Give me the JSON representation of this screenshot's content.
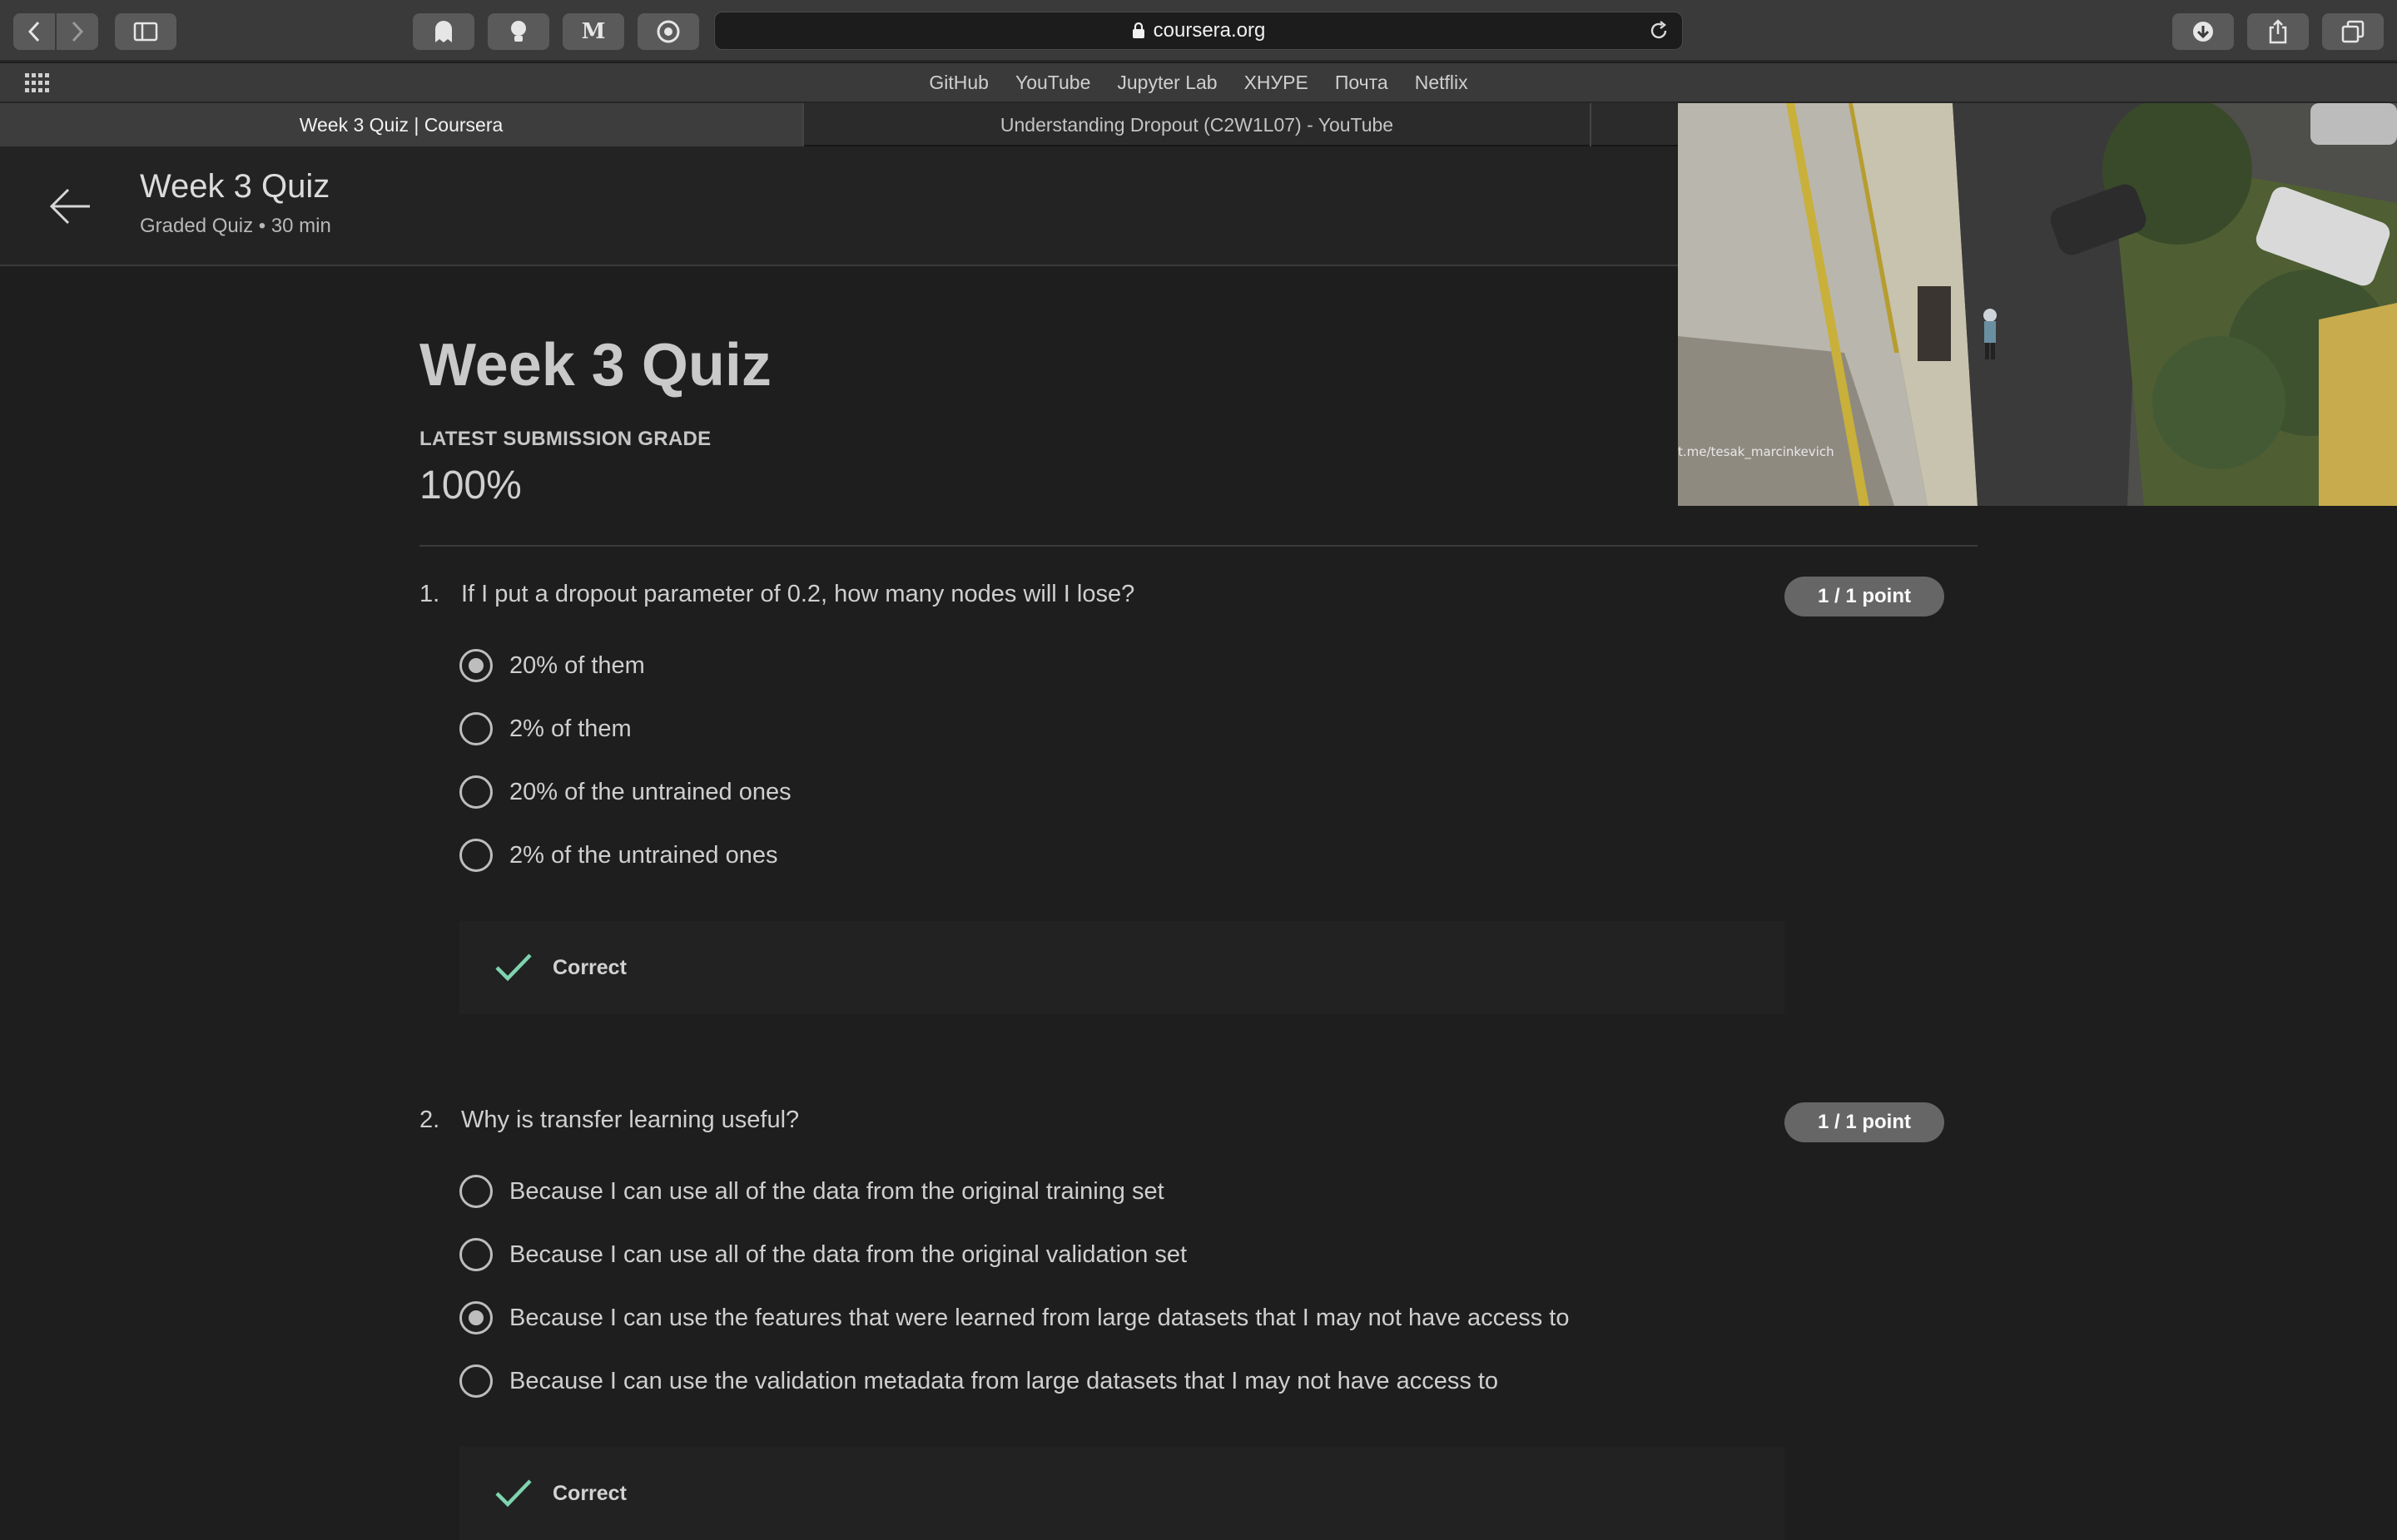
{
  "browser": {
    "url": "coursera.org",
    "favorites": [
      "GitHub",
      "YouTube",
      "Jupyter Lab",
      "ХНУРЕ",
      "Почта",
      "Netflix"
    ],
    "extension_m_label": "M",
    "tabs": [
      {
        "label": "Week 3 Quiz | Coursera",
        "active": true
      },
      {
        "label": "Understanding Dropout (C2W1L07) - YouTube",
        "active": false
      }
    ]
  },
  "header": {
    "title": "Week 3 Quiz",
    "subtitle": "Graded Quiz • 30 min"
  },
  "video": {
    "watermark": "t.me/tesak_marcinkevich"
  },
  "quiz": {
    "title": "Week 3 Quiz",
    "grade_label": "LATEST SUBMISSION GRADE",
    "grade_value": "100%",
    "questions": [
      {
        "number": "1.",
        "text": "If I put a dropout parameter of 0.2, how many nodes will I lose?",
        "points": "1 / 1 point",
        "options": [
          {
            "label": "20% of them",
            "selected": true
          },
          {
            "label": "2% of them",
            "selected": false
          },
          {
            "label": "20% of the untrained ones",
            "selected": false
          },
          {
            "label": "2% of the untrained ones",
            "selected": false
          }
        ],
        "feedback": "Correct"
      },
      {
        "number": "2.",
        "text": "Why is transfer learning useful?",
        "points": "1 / 1 point",
        "options": [
          {
            "label": "Because I can use all of the data from the original training set",
            "selected": false
          },
          {
            "label": "Because I can use all of the data from the original validation set",
            "selected": false
          },
          {
            "label": "Because I can use the features that were learned from large datasets that I may not have access to",
            "selected": true
          },
          {
            "label": "Because I can use the validation metadata from large datasets that I may not have access to",
            "selected": false
          }
        ],
        "feedback": "Correct"
      }
    ]
  },
  "colors": {
    "background": "#1e1e1e",
    "check": "#7fd4b0",
    "badge": "#666666"
  }
}
